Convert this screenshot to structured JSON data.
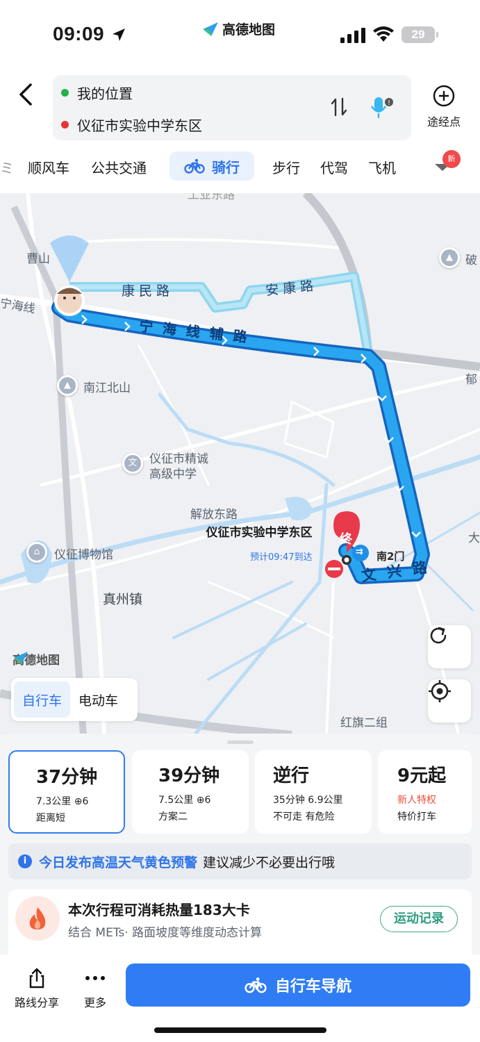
{
  "status_bar": {
    "time": "09:09",
    "app_name": "高德地图",
    "battery": "29"
  },
  "route": {
    "origin": "我的位置",
    "destination": "仪征市实验中学东区",
    "waypoint_label": "途经点",
    "origin_color": "#22b14c",
    "destination_color": "#e8353a"
  },
  "modes": [
    "顺风车",
    "公共交通",
    "骑行",
    "步行",
    "代驾",
    "飞机"
  ],
  "active_mode": "骑行",
  "new_badge": "新",
  "map": {
    "labels": {
      "caoshan": "曹山",
      "ninghai": "宁海线",
      "kangmin": "康民路",
      "ankang": "安康路",
      "ninghai_fu": "宁海线辅路",
      "nanjiang": "南江北山",
      "jingcheng": "仪征市精诚",
      "jingcheng2": "高级中学",
      "jiefang": "解放东路",
      "museum": "仪征博物馆",
      "zhenzhou": "真州镇",
      "wenxing": "文兴路",
      "nan2men": "南2门",
      "hongqi": "红旗二组",
      "po": "破",
      "yu": "郁",
      "da": "大",
      "top_road": "工业东路"
    },
    "destination_name": "仪征市实验中学东区",
    "eta": "预计09:47到达",
    "end_marker": "终",
    "logo": "高德地图",
    "route_color": "#1f8fe8"
  },
  "vehicle_switch": {
    "options": [
      "自行车",
      "电动车"
    ],
    "selected": "自行车"
  },
  "plans": [
    {
      "duration": "37分钟",
      "line1": "7.3公里 ⊕6",
      "line2": "距离短",
      "selected": true
    },
    {
      "duration": "39分钟",
      "line1": "7.5公里 ⊕6",
      "line2": "方案二",
      "selected": false
    },
    {
      "duration": "逆行",
      "line1": "35分钟 6.9公里",
      "line2": "不可走 有危险",
      "selected": false
    },
    {
      "duration": "9元起",
      "line1": "新人特权",
      "line2": "特价打车",
      "selected": false
    }
  ],
  "alert": {
    "highlight": "今日发布高温天气黄色预警",
    "text": "建议减少不必要出行哦"
  },
  "calorie": {
    "title": "本次行程可消耗热量183大卡",
    "subtitle": "结合 METs· 路面坡度等维度动态计算",
    "button": "运动记录"
  },
  "bottom_bar": {
    "share": "路线分享",
    "more": "更多",
    "navigate": "自行车导航"
  }
}
